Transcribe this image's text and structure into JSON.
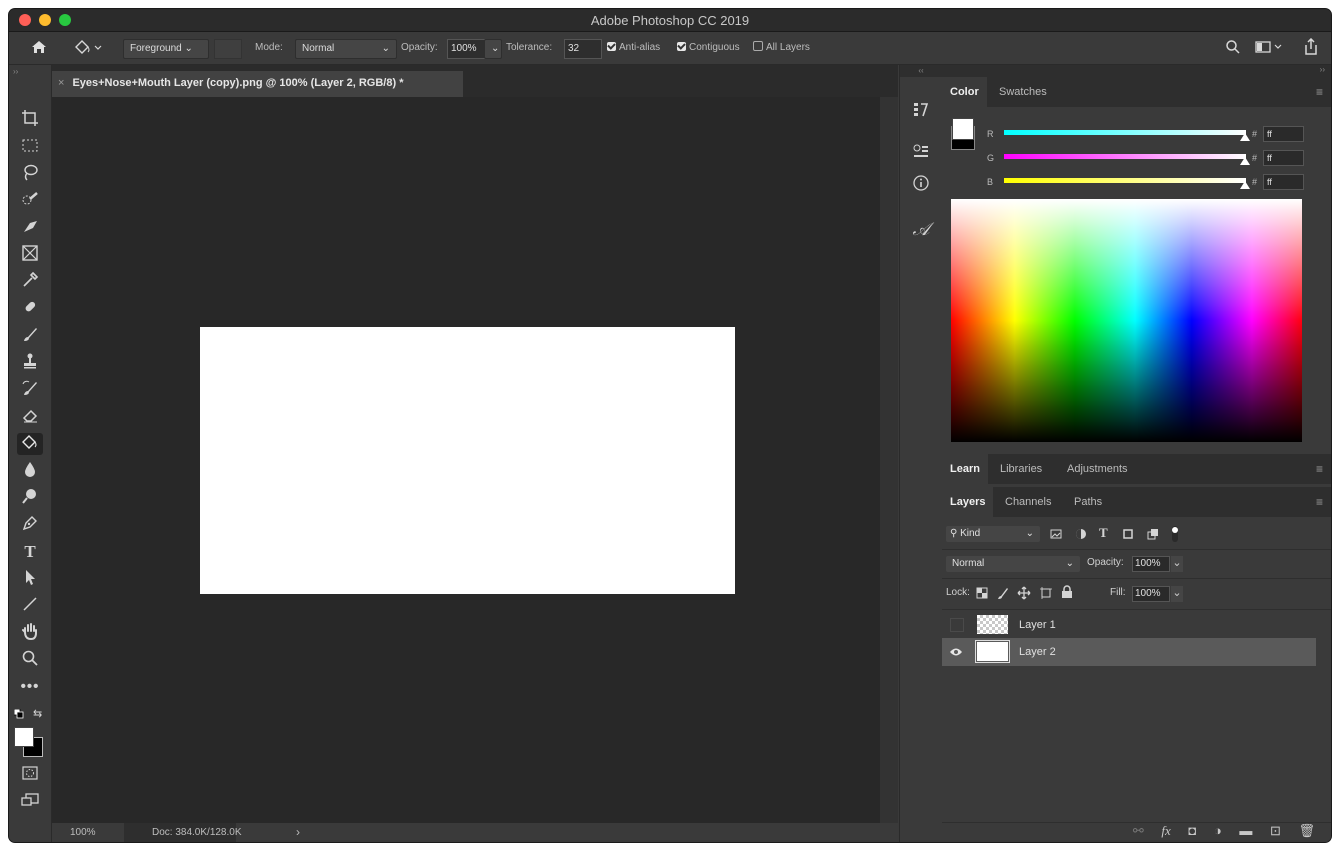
{
  "window": {
    "title": "Adobe Photoshop CC 2019"
  },
  "options": {
    "fill_source": "Foreground",
    "mode_label": "Mode:",
    "mode_value": "Normal",
    "opacity_label": "Opacity:",
    "opacity_value": "100%",
    "tolerance_label": "Tolerance:",
    "tolerance_value": "32",
    "antialias_label": "Anti-alias",
    "contiguous_label": "Contiguous",
    "alllayers_label": "All Layers"
  },
  "document": {
    "tab_title": "Eyes+Nose+Mouth Layer (copy).png @ 100% (Layer 2, RGB/8) *",
    "close_glyph": "×"
  },
  "status": {
    "zoom": "100%",
    "doc_size": "Doc: 384.0K/128.0K",
    "arrow": "›"
  },
  "color_panel": {
    "tabs": [
      "Color",
      "Swatches"
    ],
    "rows": [
      {
        "label": "R",
        "hex": "ff"
      },
      {
        "label": "G",
        "hex": "ff"
      },
      {
        "label": "B",
        "hex": "ff"
      }
    ],
    "hash": "#"
  },
  "learn_panel": {
    "tabs": [
      "Learn",
      "Libraries",
      "Adjustments"
    ]
  },
  "layers_panel": {
    "tabs": [
      "Layers",
      "Channels",
      "Paths"
    ],
    "filter_kind": "Kind",
    "blend_mode": "Normal",
    "opacity_label": "Opacity:",
    "opacity_value": "100%",
    "lock_label": "Lock:",
    "fill_label": "Fill:",
    "fill_value": "100%",
    "layers": [
      {
        "name": "Layer 1",
        "visible": false,
        "selected": false
      },
      {
        "name": "Layer 2",
        "visible": true,
        "selected": true
      }
    ]
  },
  "colors": {
    "accent_selected": "#5a5a5a",
    "canvas_bg": "#282828",
    "slider_cyan": "#00ffff",
    "slider_magenta": "#ff00ff",
    "slider_yellow": "#ffff00"
  }
}
